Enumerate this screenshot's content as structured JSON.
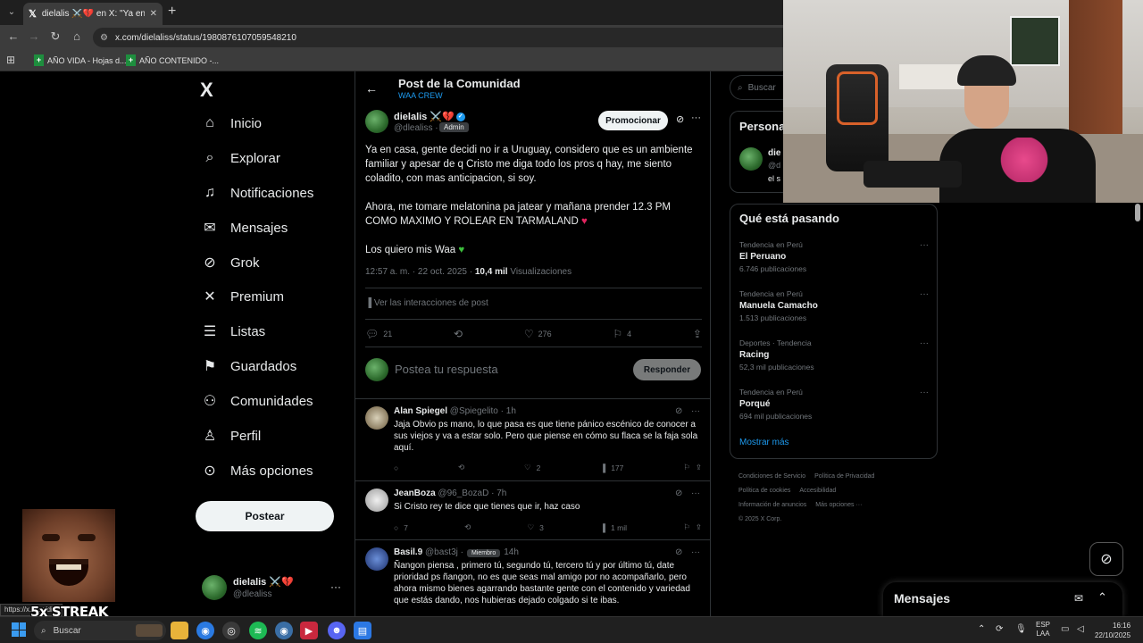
{
  "browser": {
    "tab_title": "dielalis ⚔️💔 en X: \"Ya en casa,",
    "tab_icon": "x-logo-icon",
    "site_icon": "site-info-icon",
    "url": "x.com/dielaliss/status/1980876107059548210",
    "bookmarks": [
      {
        "label": "AÑO VIDA - Hojas d..."
      },
      {
        "label": "AÑO CONTENIDO -..."
      }
    ],
    "status_url": "https://x.com/di..."
  },
  "nav": {
    "logo": "X",
    "items": [
      {
        "label": "Inicio",
        "icon": "home-icon"
      },
      {
        "label": "Explorar",
        "icon": "search-icon"
      },
      {
        "label": "Notificaciones",
        "icon": "bell-icon"
      },
      {
        "label": "Mensajes",
        "icon": "mail-icon"
      },
      {
        "label": "Grok",
        "icon": "grok-icon"
      },
      {
        "label": "Premium",
        "icon": "x-premium-icon"
      },
      {
        "label": "Listas",
        "icon": "list-icon"
      },
      {
        "label": "Guardados",
        "icon": "bookmark-icon"
      },
      {
        "label": "Comunidades",
        "icon": "communities-icon"
      },
      {
        "label": "Perfil",
        "icon": "person-icon"
      },
      {
        "label": "Más opciones",
        "icon": "more-circle-icon"
      }
    ],
    "post_button": "Postear",
    "account": {
      "name": "dielalis ⚔️💔",
      "handle": "@dlealiss"
    }
  },
  "header": {
    "title": "Post de la Comunidad",
    "community": "WAA CREW"
  },
  "post": {
    "author": "dielalis ⚔️💔",
    "handle": "@dlealiss ·",
    "badge": "Admin",
    "promote": "Promocionar",
    "text1": "Ya en casa, gente decidi no ir a Uruguay, considero que es un ambiente familiar y apesar de q Cristo me diga todo los pros q hay, me siento coladito, con mas anticipacion, si soy.",
    "text2": "Ahora, me tomare melatonina pa jatear y mañana prender 12.3 PM COMO MAXIMO Y ROLEAR EN TARMALAND",
    "text2_emoji": "♥",
    "text3": "Los quiero mis Waa",
    "text3_emoji": "♥",
    "time": "12:57 a. m. · 22 oct. 2025 ·",
    "views": "10,4 mil",
    "views_label": "Visualizaciones",
    "interactions": "Ver las interacciones de post",
    "counts": {
      "replies": "21",
      "retweets": "",
      "likes": "276",
      "bookmarks": "4"
    }
  },
  "reply_box": {
    "placeholder": "Postea tu respuesta",
    "button": "Responder"
  },
  "replies": [
    {
      "name": "Alan Spiegel",
      "handle": "@Spiegelito · 1h",
      "tag": "",
      "text": "Jaja Obvio ps mano, lo que pasa es que tiene pánico escénico de conocer a sus viejos y va a estar solo. Pero que piense en cómo su flaca se la faja sola aquí.",
      "replies": "",
      "retweets": "",
      "likes": "2",
      "views": "177"
    },
    {
      "name": "JeanBoza",
      "handle": "@96_BozaD · 7h",
      "tag": "",
      "text": "Si Cristo rey te dice que tienes que ir, haz caso",
      "replies": "7",
      "retweets": "",
      "likes": "3",
      "views": "1 mil"
    },
    {
      "name": "Basil.9",
      "handle": "@bast3j ·",
      "tag": "Miembro",
      "time": "14h",
      "text": "Ñangon piensa , primero tú, segundo tú, tercero tú y por último tú, date prioridad ps ñangon, no es que seas mal amigo por no acompañarlo, pero ahora mismo bienes agarrando bastante gente con el contenido y variedad que estás dando, nos hubieras dejado colgado si te ibas.",
      "replies": "",
      "retweets": "",
      "likes": "",
      "views": ""
    }
  ],
  "right": {
    "search_placeholder": "Buscar",
    "persona_title": "Persona",
    "persona_name": "die",
    "persona_handle": "@d",
    "persona_bio": "el s",
    "trends_title": "Qué está pasando",
    "trends": [
      {
        "context": "Tendencia en Perú",
        "name": "El Peruano",
        "count": "6.746 publicaciones"
      },
      {
        "context": "Tendencia en Perú",
        "name": "Manuela Camacho",
        "count": "1.513 publicaciones"
      },
      {
        "context": "Deportes · Tendencia",
        "name": "Racing",
        "count": "52,3 mil publicaciones"
      },
      {
        "context": "Tendencia en Perú",
        "name": "Porqué",
        "count": "694 mil publicaciones"
      }
    ],
    "show_more": "Mostrar más",
    "footer": [
      "Condiciones de Servicio",
      "Política de Privacidad",
      "Política de cookies",
      "Accesibilidad",
      "Información de anuncios",
      "Más opciones ···",
      "© 2025 X Corp."
    ]
  },
  "messages_dock": {
    "title": "Mensajes"
  },
  "overlay": {
    "streak": "5x STREAK"
  },
  "taskbar": {
    "search": "Buscar",
    "lang": "ESP",
    "lang2": "LAA",
    "time": "16:16",
    "date": "22/10/2025"
  },
  "colors": {
    "accent": "#1d9bf0",
    "background": "#000000",
    "muted": "#71767b",
    "text": "#e7e9ea"
  }
}
